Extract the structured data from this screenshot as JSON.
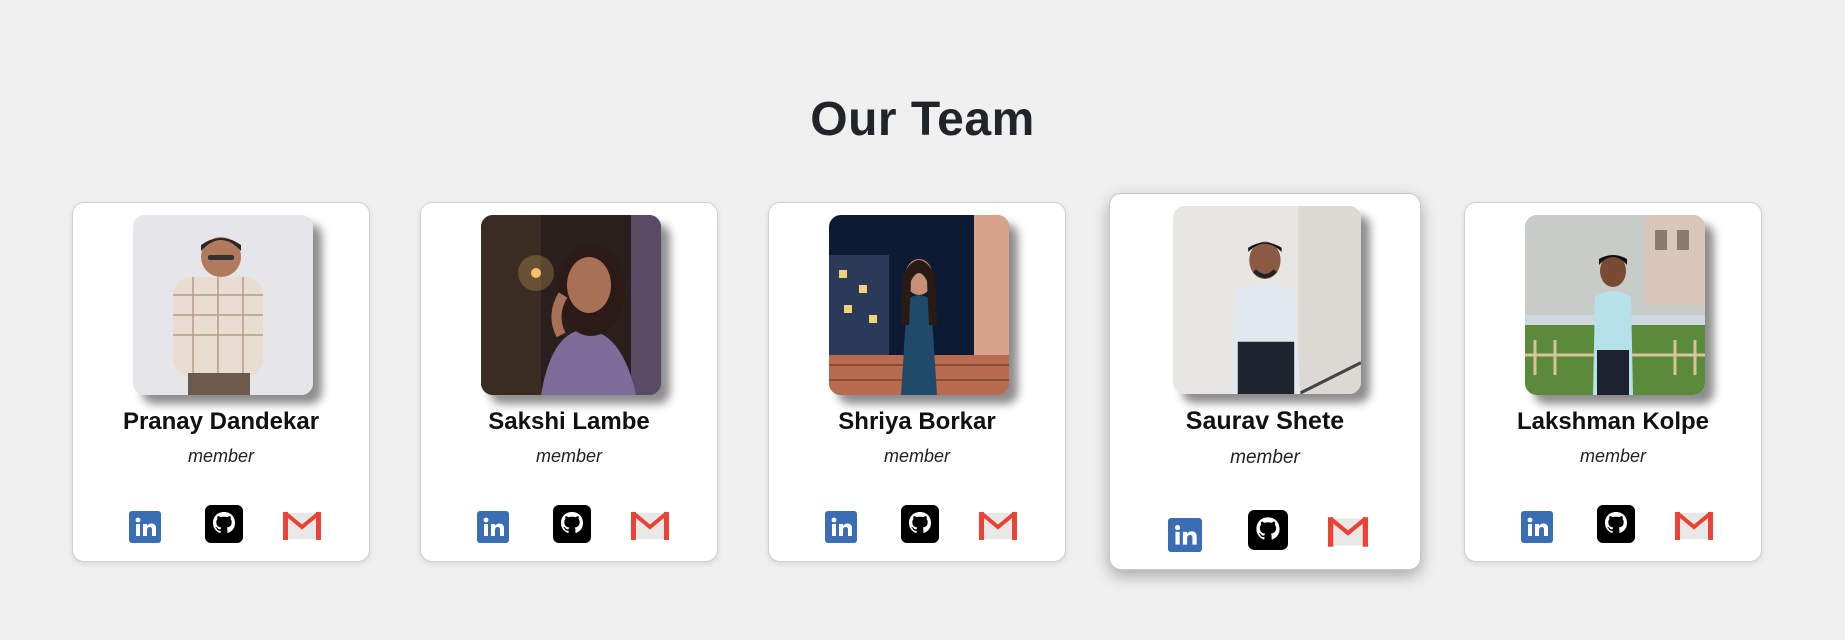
{
  "page": {
    "title": "Our Team"
  },
  "members": [
    {
      "name": "Pranay Dandekar",
      "role": "member"
    },
    {
      "name": "Sakshi Lambe",
      "role": "member"
    },
    {
      "name": "Shriya Borkar",
      "role": "member"
    },
    {
      "name": "Saurav Shete",
      "role": "member"
    },
    {
      "name": "Lakshman Kolpe",
      "role": "member"
    }
  ],
  "social_icons": [
    "linkedin-icon",
    "github-icon",
    "gmail-icon"
  ],
  "colors": {
    "background": "#f0f0f0",
    "card": "#ffffff",
    "linkedin": "#3b6db4",
    "github": "#000000",
    "gmail": "#ea4335"
  }
}
